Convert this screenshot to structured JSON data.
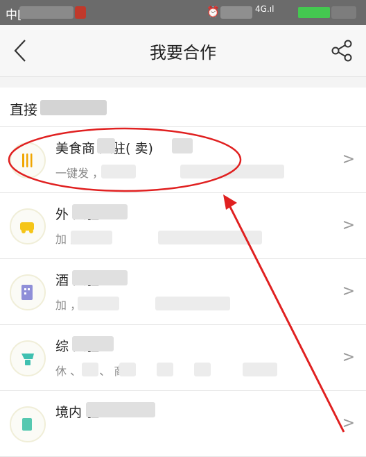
{
  "status_bar": {
    "carrier": "中[",
    "network": "4G",
    "colors": {
      "background": "#6b6b6b",
      "battery": "#44c850"
    }
  },
  "nav": {
    "back_icon": "chevron-left-icon",
    "title": "我要合作",
    "share_icon": "share-icon"
  },
  "section": {
    "title": "直接"
  },
  "items": [
    {
      "title": "美食商  入驻(  卖)",
      "subtitle": "一键发  ，免费",
      "icon": "fork-knife-icon",
      "icon_color": "#f0a500"
    },
    {
      "title": "外  入驻",
      "subtitle": "加  卖，实",
      "icon": "delivery-icon",
      "icon_color": "#f5c518"
    },
    {
      "title": "酒  入驻",
      "subtitle": "加  ，实  长",
      "icon": "hotel-icon",
      "icon_color": "#8f8fd8"
    },
    {
      "title": "综  入驻",
      "subtitle": "休  、  、  、  商家",
      "icon": "shop-icon",
      "icon_color": "#3fc0b0"
    },
    {
      "title": "境内  驻",
      "subtitle": "",
      "icon": "globe-icon",
      "icon_color": "#56c8b0"
    }
  ],
  "chevron_glyph": ">",
  "annotation_color": "#e02020"
}
